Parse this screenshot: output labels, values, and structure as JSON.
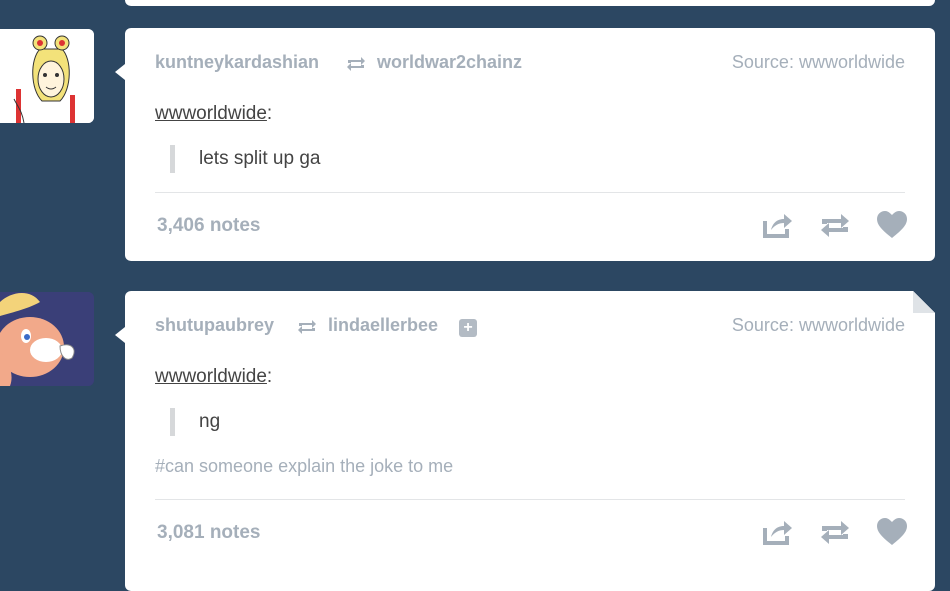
{
  "colors": {
    "background": "#2c4762",
    "card": "#ffffff",
    "muted": "#a5afba",
    "text": "#444444"
  },
  "posts": [
    {
      "user": "kuntneykardashian",
      "reblogged_from": "worldwar2chainz",
      "source_label": "Source:",
      "source_name": "wwworldwide",
      "quote_author": "wwworldwide",
      "quote_colon": ":",
      "quote_text": "lets split up ga",
      "notes": "3,406 notes",
      "avatar": "sailor-moon-avatar",
      "icons": [
        "share-icon",
        "reblog-icon",
        "heart-icon"
      ]
    },
    {
      "user": "shutupaubrey",
      "reblogged_from": "lindaellerbee",
      "follow_symbol": "+",
      "source_label": "Source:",
      "source_name": "wwworldwide",
      "quote_author": "wwworldwide",
      "quote_colon": ":",
      "quote_text": "ng",
      "tag": "#can someone explain the joke to me",
      "notes": "3,081 notes",
      "avatar": "bunny-avatar",
      "icons": [
        "share-icon",
        "reblog-icon",
        "heart-icon"
      ]
    }
  ]
}
